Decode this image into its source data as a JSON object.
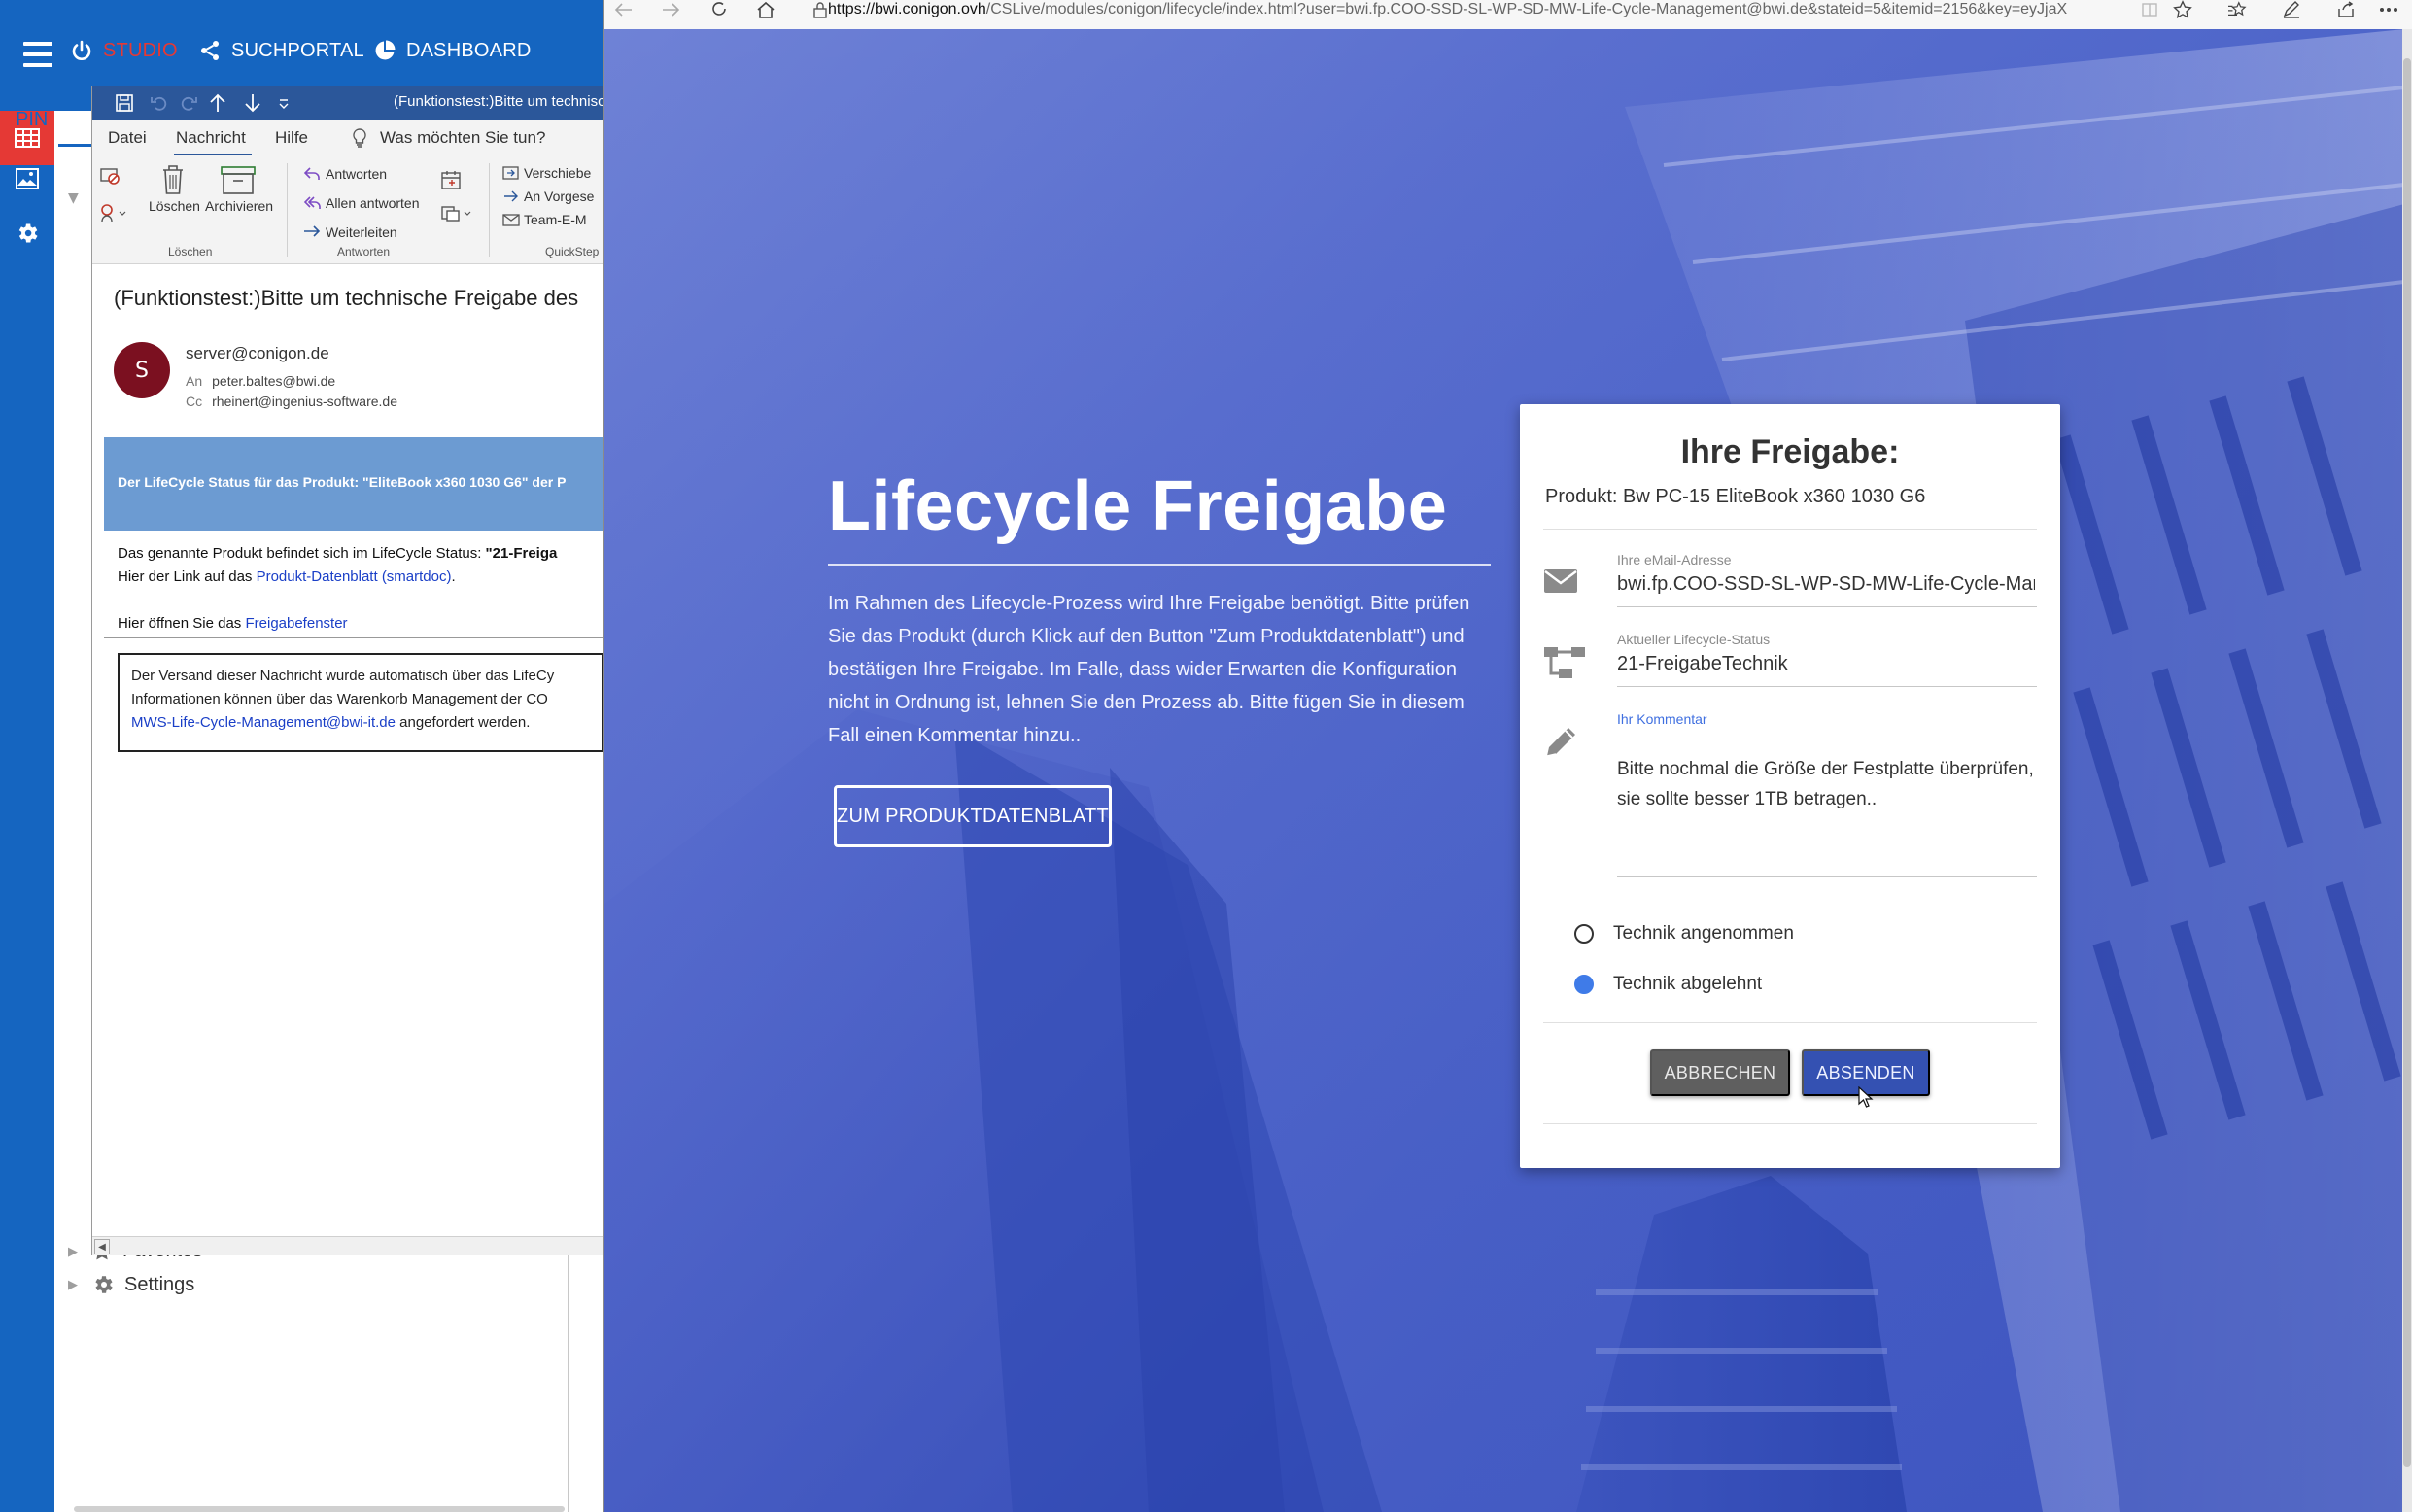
{
  "studio": {
    "nav": {
      "studio_label": "STUDIO",
      "suchportal_label": "SUCHPORTAL",
      "dashboard_label": "DASHBOARD"
    },
    "tab_label": "PIN",
    "tree": {
      "favorites_label": "Favorites",
      "settings_label": "Settings"
    },
    "accent_color": "#1565c0",
    "active_color": "#e53935"
  },
  "outlook": {
    "window_title": "(Funktionstest:)Bitte um technische",
    "menu": {
      "datei": "Datei",
      "nachricht": "Nachricht",
      "hilfe": "Hilfe",
      "tellme": "Was möchten Sie tun?"
    },
    "ribbon": {
      "loeschen_label": "Löschen",
      "archivieren_label": "Archivieren",
      "group_loeschen": "Löschen",
      "antworten_label": "Antworten",
      "allen_antworten_label": "Allen antworten",
      "weiterleiten_label": "Weiterleiten",
      "group_antworten": "Antworten",
      "verschieben_label": "Verschiebe",
      "an_vorgesetzte_label": "An Vorgese",
      "team_email_label": "Team-E-M",
      "group_quicksteps": "QuickStep"
    },
    "message": {
      "subject": "(Funktionstest:)Bitte um technische Freigabe des",
      "avatar_letter": "S",
      "from": "server@conigon.de",
      "to_label": "An",
      "to": "peter.baltes@bwi.de",
      "cc_label": "Cc",
      "cc": "rheinert@ingenius-software.de",
      "banner": "Der LifeCycle Status für das Produkt: \"EliteBook x360 1030 G6\" der P",
      "body_line1_prefix": "Das genannte Produkt befindet sich im LifeCycle Status: ",
      "body_line1_status": "\"21-Freiga",
      "body_line2_prefix": "Hier der Link auf das ",
      "body_line2_link": "Produkt-Datenblatt (smartdoc)",
      "body_line2_suffix": ".",
      "body_line3_prefix": "Hier öffnen Sie das ",
      "body_line3_link": "Freigabefenster",
      "note_line1": "Der Versand dieser Nachricht wurde automatisch über das LifeCy",
      "note_line2": "Informationen können über das Warenkorb Management der CO",
      "note_link": "MWS-Life-Cycle-Management@bwi-it.de",
      "note_line3_suffix": " angefordert werden."
    }
  },
  "browser": {
    "url_host": "https://bwi.conigon.ovh",
    "url_path": "/CSLive/modules/conigon/lifecycle/index.html?user=bwi.fp.COO-SSD-SL-WP-SD-MW-Life-Cycle-Management@bwi.de&stateid=5&itemid=2156&key=eyJjaX"
  },
  "hero": {
    "title": "Lifecycle Freigabe",
    "text": "Im Rahmen des Lifecycle-Prozess wird Ihre Freigabe benötigt. Bitte prüfen Sie das Produkt (durch Klick auf den Button \"Zum Produktdatenblatt\") und bestätigen Ihre Freigabe. Im Falle, dass wider Erwarten die Konfiguration nicht in Ordnung ist, lehnen Sie den Prozess ab. Bitte fügen Sie in diesem Fall einen Kommentar hinzu..",
    "button_label": "ZUM PRODUKTDATENBLATT"
  },
  "card": {
    "title": "Ihre Freigabe:",
    "product": "Produkt: Bw PC-15 EliteBook x360 1030 G6",
    "email": {
      "label": "Ihre eMail-Adresse",
      "value": "bwi.fp.COO-SSD-SL-WP-SD-MW-Life-Cycle-Management@bwi.de"
    },
    "status": {
      "label": "Aktueller Lifecycle-Status",
      "value": "21-FreigabeTechnik"
    },
    "comment": {
      "label": "Ihr Kommentar",
      "value": "Bitte nochmal die Größe der Festplatte überprüfen, sie sollte besser 1TB betragen.."
    },
    "options": [
      {
        "label": "Technik angenommen",
        "selected": false
      },
      {
        "label": "Technik abgelehnt",
        "selected": true
      }
    ],
    "cancel_label": "ABBRECHEN",
    "submit_label": "ABSENDEN",
    "submit_color": "#3451b2",
    "radio_color": "#3f7be8"
  }
}
